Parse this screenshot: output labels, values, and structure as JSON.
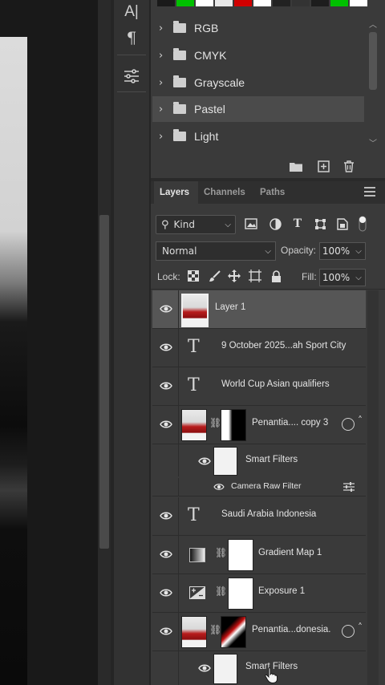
{
  "swatch_colors": [
    "#1a1a1a",
    "#00c000",
    "#ffffff",
    "#e8e8e8",
    "#d00000",
    "#ffffff",
    "#222222",
    "#333333",
    "#1d1d1d",
    "#00c000",
    "#ffffff"
  ],
  "tools": [
    {
      "icon": "character-icon",
      "glyph": "A|"
    },
    {
      "icon": "paragraph-icon",
      "glyph": "¶"
    },
    {
      "icon": "adjustments-icon",
      "glyph": "⚙"
    }
  ],
  "swatch_groups": [
    {
      "label": "RGB",
      "selected": false
    },
    {
      "label": "CMYK",
      "selected": false
    },
    {
      "label": "Grayscale",
      "selected": false
    },
    {
      "label": "Pastel",
      "selected": true
    },
    {
      "label": "Light",
      "selected": false
    }
  ],
  "swatch_footer_icons": [
    "new-group-folder-icon",
    "new-swatch-icon",
    "delete-icon"
  ],
  "tabs": [
    {
      "label": "Layers",
      "active": true
    },
    {
      "label": "Channels",
      "active": false
    },
    {
      "label": "Paths",
      "active": false
    }
  ],
  "filter": {
    "kind": "Kind",
    "icons": [
      "pixel-filter-icon",
      "adjustment-filter-icon",
      "type-filter-icon",
      "shape-filter-icon",
      "smart-object-filter-icon",
      "filter-toggle-icon"
    ]
  },
  "blend": {
    "mode": "Normal",
    "opacity_label": "Opacity:",
    "opacity": "100%"
  },
  "lock": {
    "label": "Lock:",
    "fill_label": "Fill:",
    "fill": "100%"
  },
  "layers": [
    {
      "name": "Layer 1",
      "kind": "pixel",
      "selected": true
    },
    {
      "name": "9 October 2025...ah Sport City",
      "kind": "text"
    },
    {
      "name": "World Cup Asian qualifiers",
      "kind": "text"
    },
    {
      "name": "Penantia.... copy 3",
      "kind": "smart"
    },
    {
      "name": "Smart Filters",
      "kind": "smart-filters"
    },
    {
      "name": "Camera Raw Filter",
      "kind": "filter"
    },
    {
      "name": "Saudi Arabia Indonesia",
      "kind": "text"
    },
    {
      "name": "Gradient Map 1",
      "kind": "adjustment"
    },
    {
      "name": "Exposure 1",
      "kind": "adjustment"
    },
    {
      "name": "Penantia...donesia.",
      "kind": "smart"
    },
    {
      "name": "Smart Filters",
      "kind": "smart-filters"
    }
  ]
}
